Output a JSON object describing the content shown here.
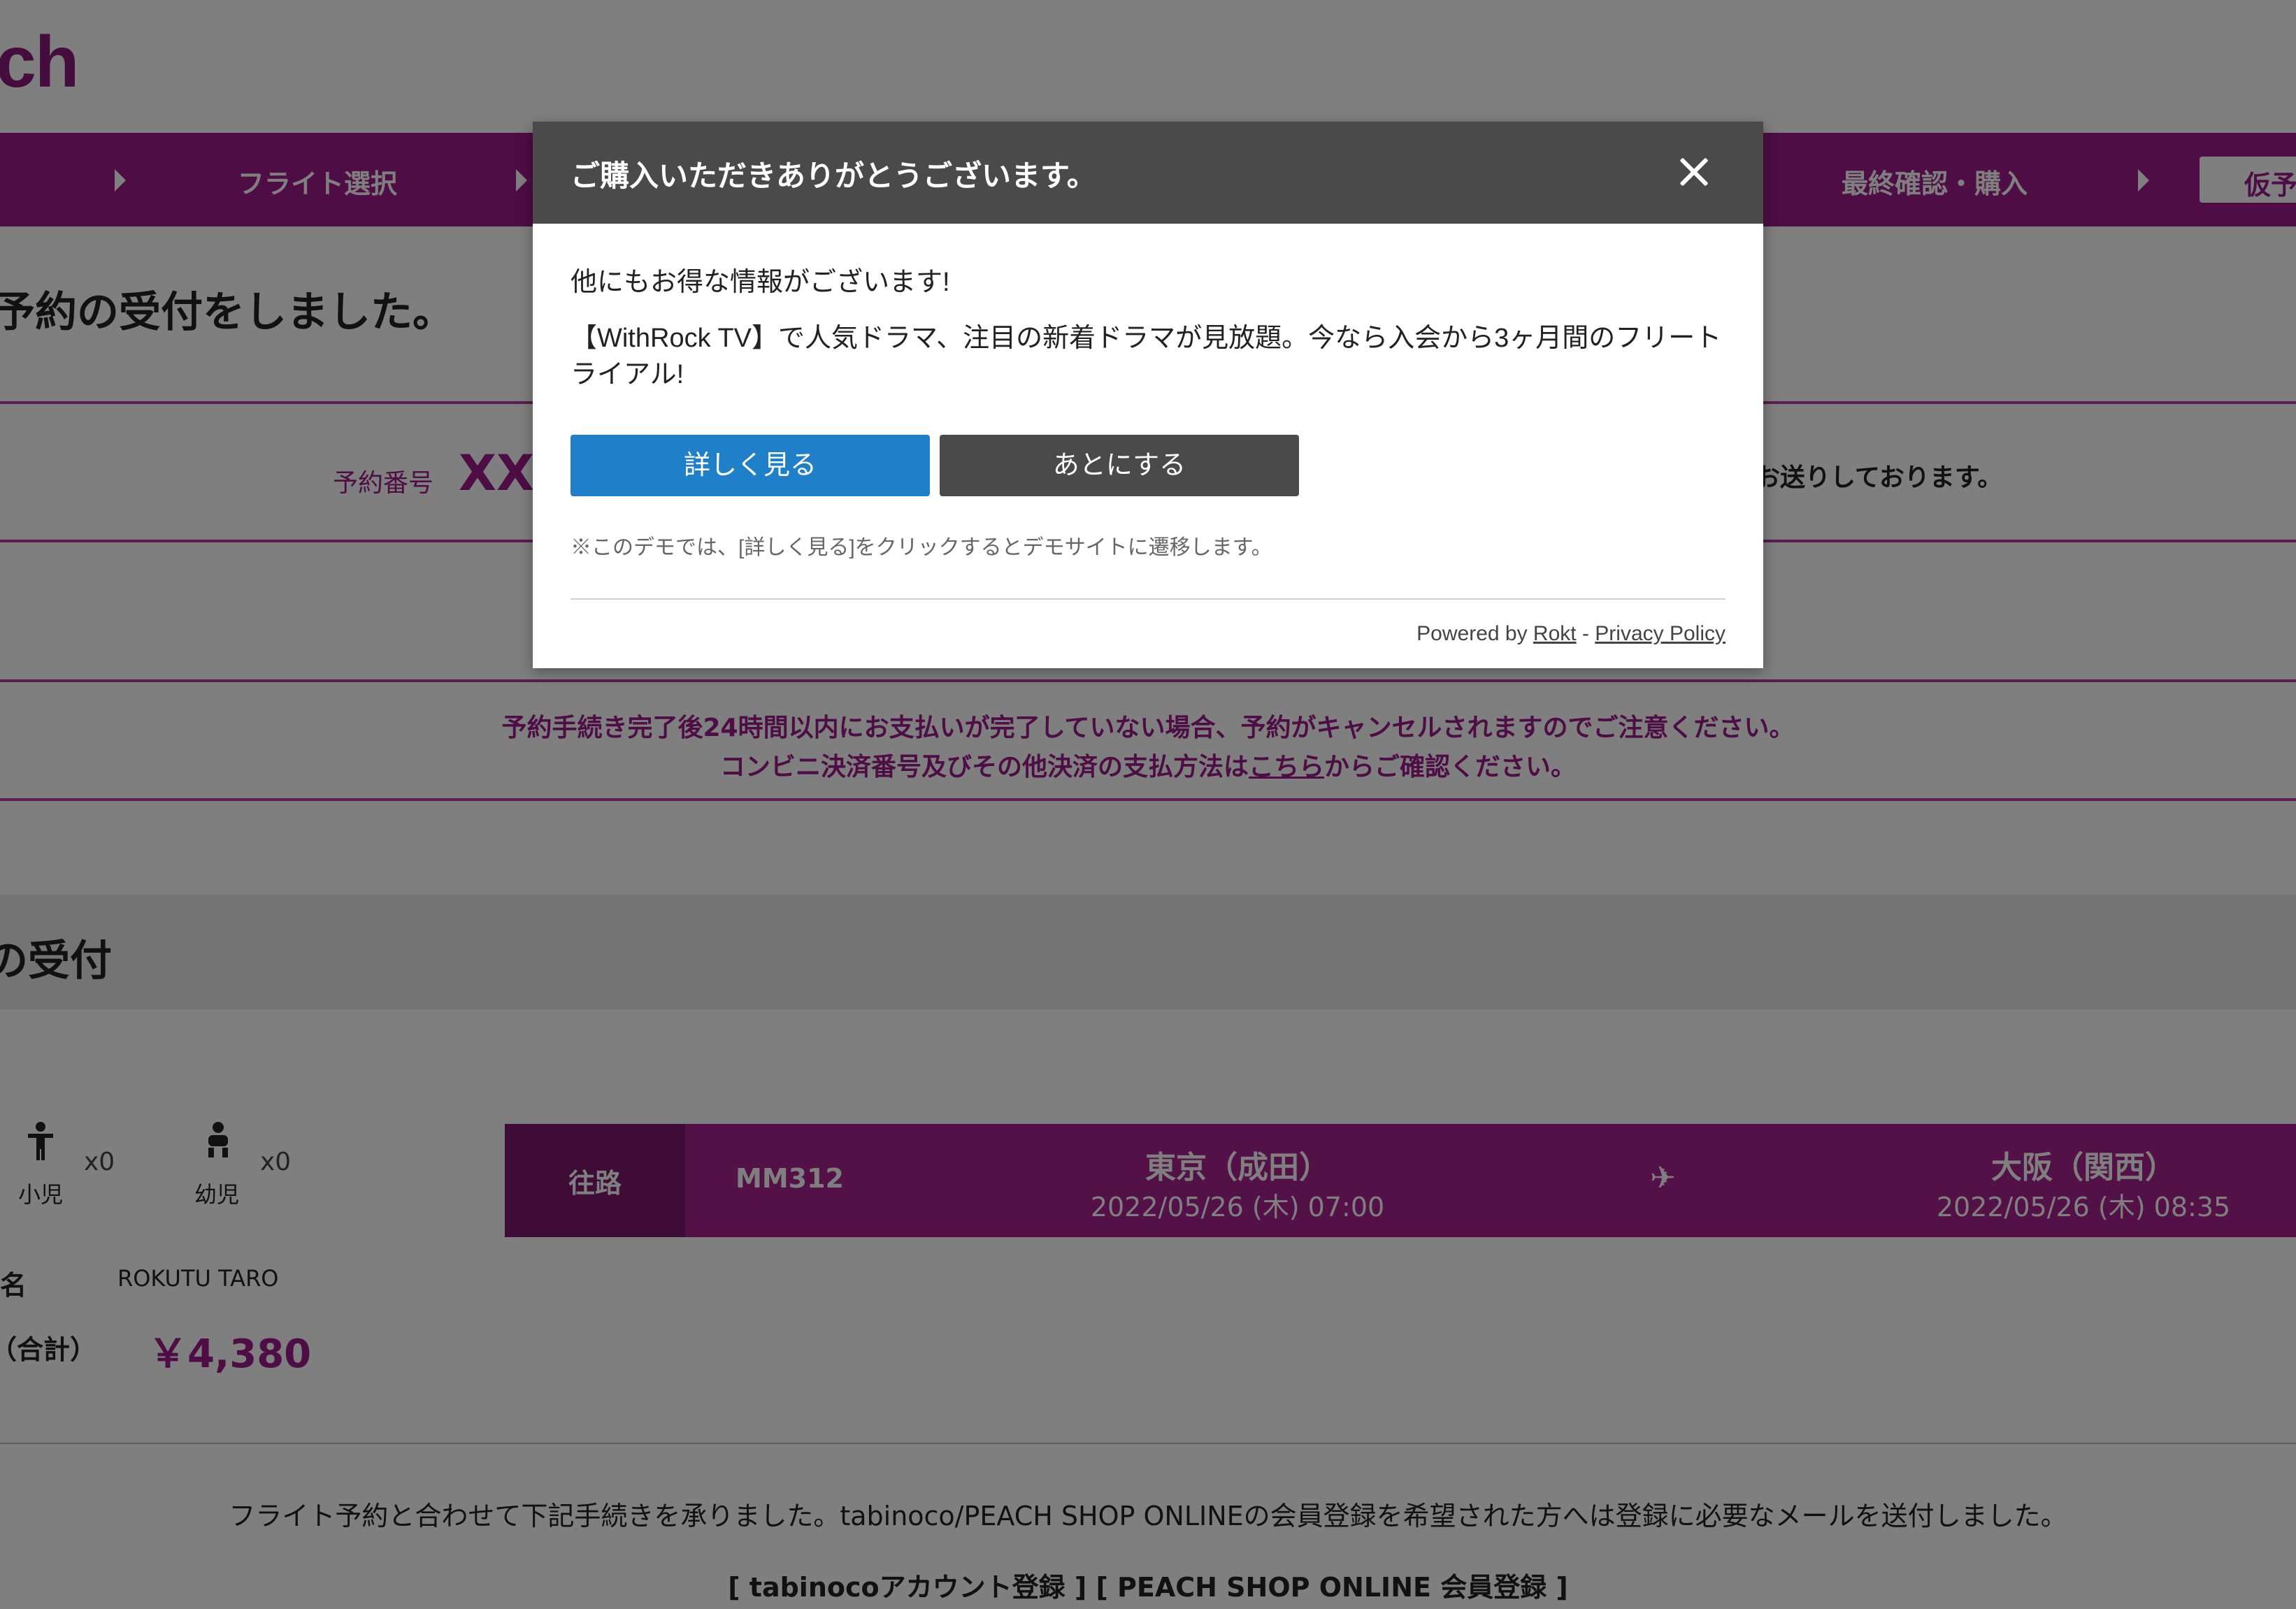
{
  "page": {
    "logo_text": "ch",
    "steps": [
      {
        "label": "フライト選択"
      },
      {
        "label": "最終確認・購入"
      }
    ],
    "active_step": "仮予",
    "heading": "予約の受付をしました。",
    "reservation": {
      "label": "予約番号",
      "number": "XXX",
      "mail_text": "お送りしております。"
    },
    "notice": {
      "line1": "予約手続き完了後24時間以内にお支払いが完了していない場合、予約がキャンセルされますのでご注意ください。",
      "line2_prefix": "コンビニ決済番号及びその他決済の支払方法は",
      "line2_link": "こちら",
      "line2_suffix": "からご確認ください。"
    },
    "section_heading": "の受付",
    "passengers": [
      {
        "label": "小児",
        "count": "x0",
        "icon": "child-icon"
      },
      {
        "label": "幼児",
        "count": "x0",
        "icon": "infant-icon"
      }
    ],
    "flight": {
      "direction": "往路",
      "number": "MM312",
      "from_city": "東京（成田）",
      "from_time": "2022/05/26 (木) 07:00",
      "to_city": "大阪（関西）",
      "to_time": "2022/05/26 (木) 08:35",
      "plane_icon": "airplane-icon"
    },
    "name_label": "名",
    "name_value": "ROKUTU TARO",
    "total_label": "（合計）",
    "total_value": "￥4,380",
    "bottom_text": "フライト予約と合わせて下記手続きを承りました。tabinoco/PEACH SHOP ONLINEの会員登録を希望された方へは登録に必要なメールを送付しました。",
    "links": "[ tabinocoアカウント登録 ]   [ PEACH SHOP ONLINE 会員登録 ]"
  },
  "modal": {
    "title": "ご購入いただきありがとうございます。",
    "subtitle": "他にもお得な情報がございます!",
    "body": "【WithRock TV】で人気ドラマ、注目の新着ドラマが見放題。今なら入会から3ヶ月間のフリートライアル!",
    "primary_label": "詳しく見る",
    "secondary_label": "あとにする",
    "note": "※このデモでは、[詳しく見る]をクリックするとデモサイトに遷移します。",
    "footer_prefix": "Powered by ",
    "footer_rokt": "Rokt",
    "footer_sep": " - ",
    "footer_privacy": "Privacy Policy"
  },
  "colors": {
    "brand": "#9c1a8a",
    "primary_button": "#1f80c9",
    "secondary_button": "#4a4a4a"
  }
}
